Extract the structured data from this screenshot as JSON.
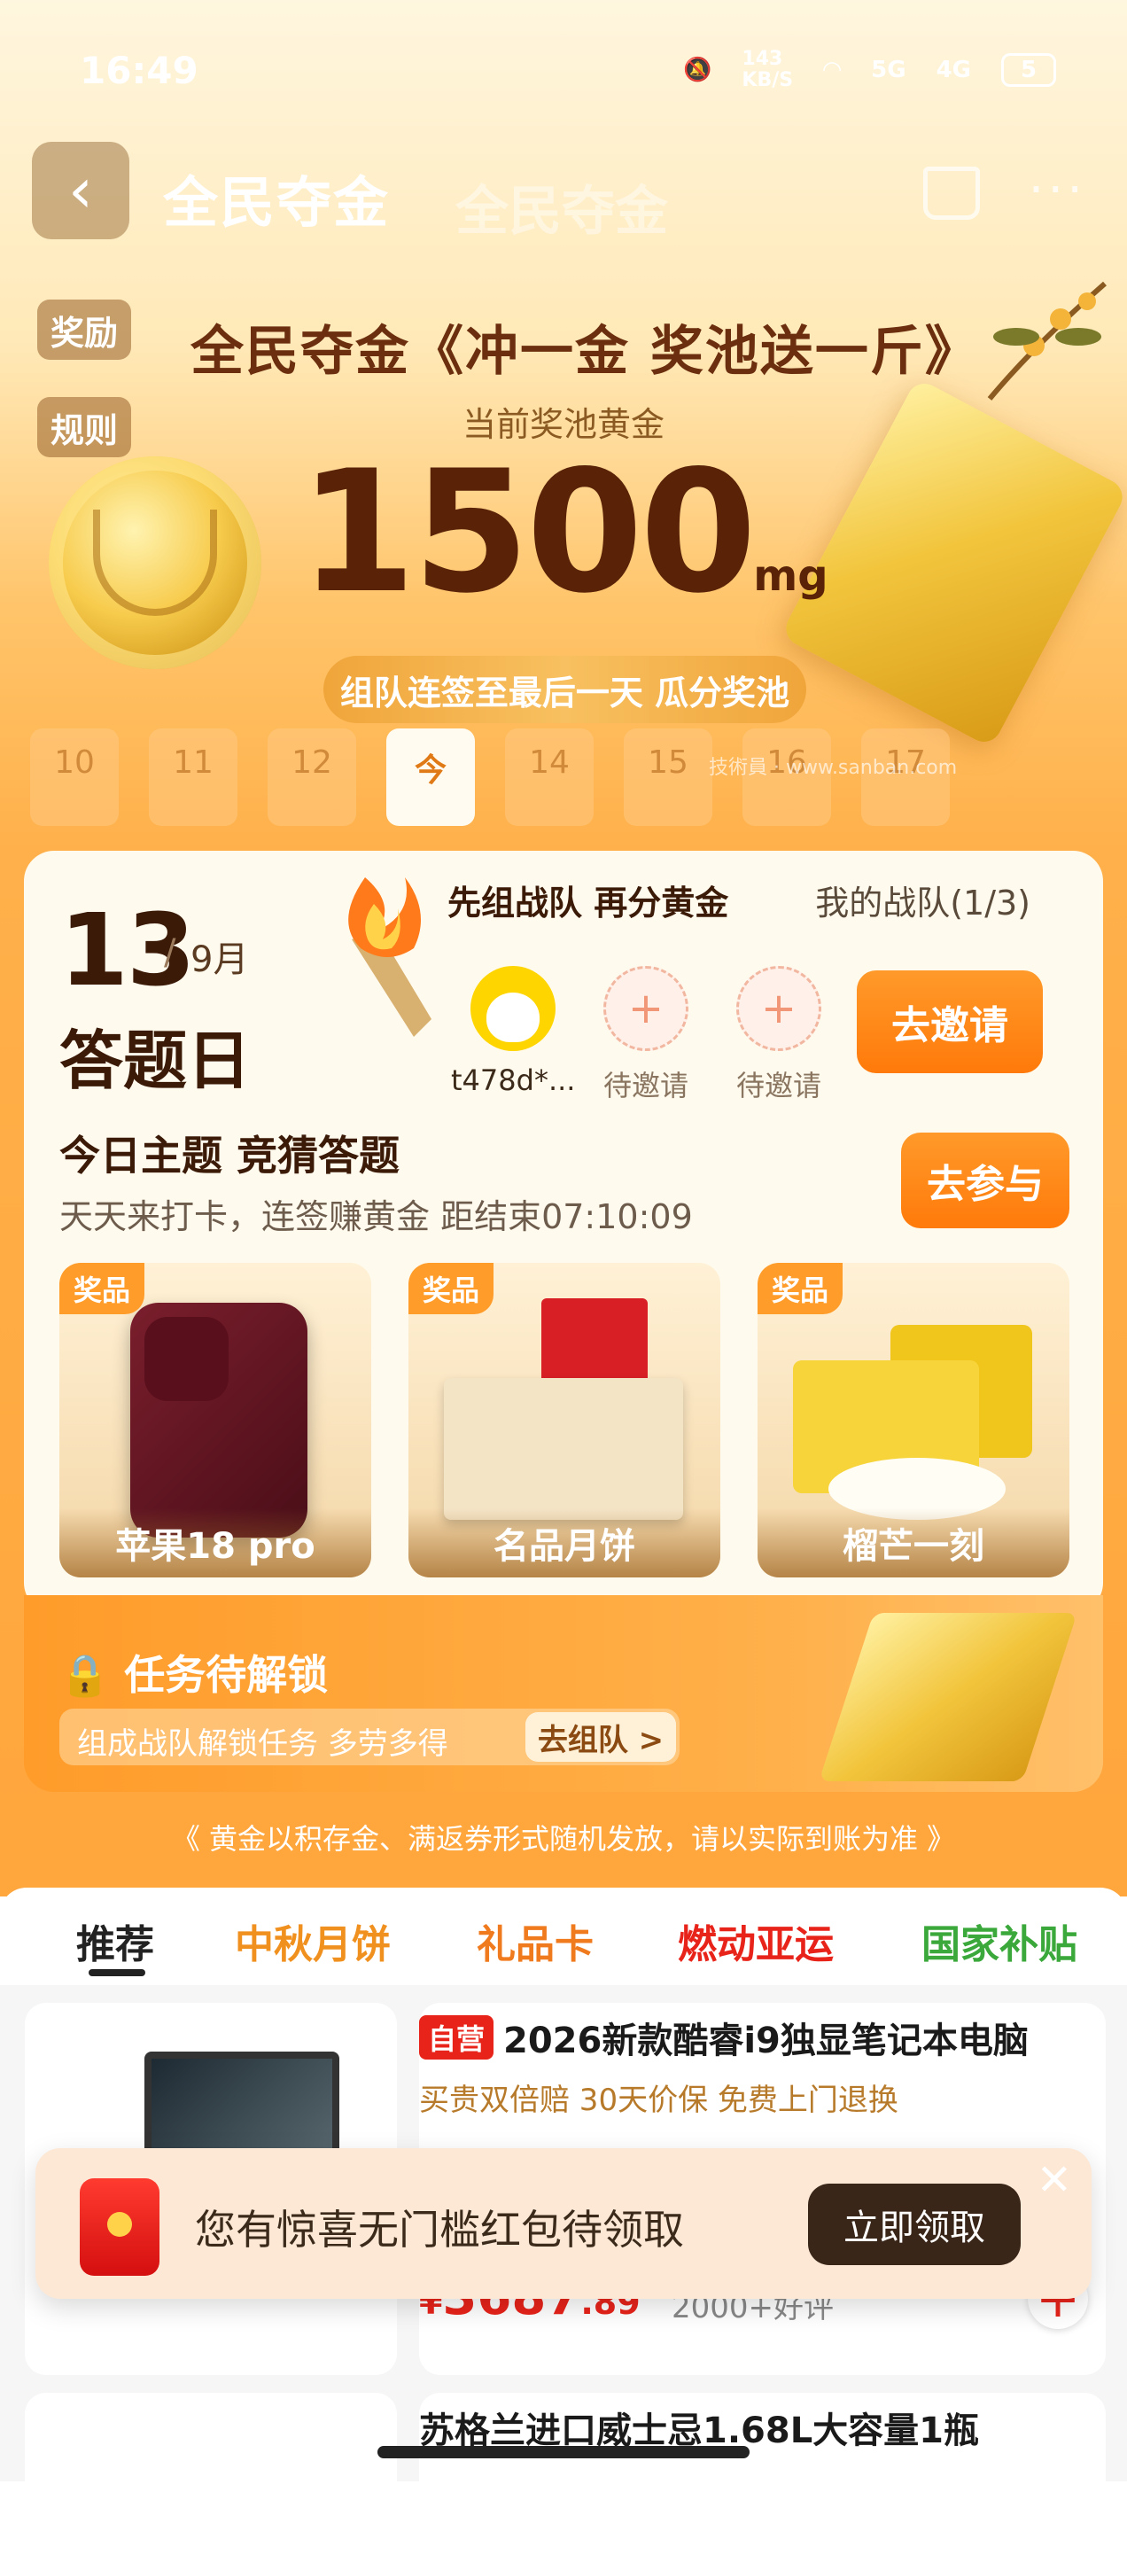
{
  "status_bar": {
    "time": "16:49",
    "net_speed_value": "143",
    "net_speed_unit": "KB/S",
    "signal1": "5G",
    "signal2": "4G",
    "battery": "5"
  },
  "nav": {
    "title": "全民夺金",
    "ghost_title": "全民夺金"
  },
  "side_tags": {
    "reward": "奖励",
    "rules": "规则"
  },
  "banner": {
    "title": "全民夺金《冲一金 奖池送一斤》",
    "pool_label": "当前奖池黄金",
    "pool_amount": "1500",
    "pool_unit": "mg",
    "team_ribbon": "组队连签至最后一天 瓜分奖池"
  },
  "days": [
    "10",
    "11",
    "12",
    "今",
    "14",
    "15",
    "16",
    "17"
  ],
  "watermark": "技術員 · www.sanban.com",
  "card": {
    "date_day": "13",
    "date_sep": "/",
    "date_month": "9月",
    "day_type": "答题日",
    "team_head": "先组战队 再分黄金",
    "my_team": "我的战队(1/3)",
    "members": [
      {
        "name": "t478d*..."
      },
      {
        "name": "待邀请"
      },
      {
        "name": "待邀请"
      }
    ],
    "invite_btn": "去邀请",
    "today_theme": "今日主题 竞猜答题",
    "today_sub": "天天来打卡，连签赚黄金   距结束07:10:09",
    "join_btn": "去参与",
    "prize_tag": "奖品",
    "prizes": [
      {
        "name": "苹果18 pro"
      },
      {
        "name": "名品月饼"
      },
      {
        "name": "榴芒一刻"
      }
    ]
  },
  "task": {
    "title": "任务待解锁",
    "desc": "组成战队解锁任务 多劳多得",
    "btn": "去组队 >"
  },
  "notice": "《 黄金以积存金、满返券形式随机发放，请以实际到账为准 》",
  "tabs": [
    {
      "label": "推荐",
      "color": "#222222"
    },
    {
      "label": "中秋月饼",
      "color": "#f0901e"
    },
    {
      "label": "礼品卡",
      "color": "#f07a1e"
    },
    {
      "label": "燃动亚运",
      "color": "#e8231a"
    },
    {
      "label": "国家补贴",
      "color": "#3aa83a"
    }
  ],
  "product": {
    "tag": "自营",
    "title": "2026新款酷睿i9独显笔记本电脑",
    "features": "买贵双倍赔  30天价保  免费上门退换",
    "price_symbol": "¥",
    "price_int": "3687",
    "price_dec": ".89",
    "reviews": "2000+好评"
  },
  "product2": {
    "title": "苏格兰进口威士忌1.68L大容量1瓶"
  },
  "popup": {
    "text": "您有惊喜无门槛红包待领取",
    "btn": "立即领取",
    "close": "✕"
  }
}
